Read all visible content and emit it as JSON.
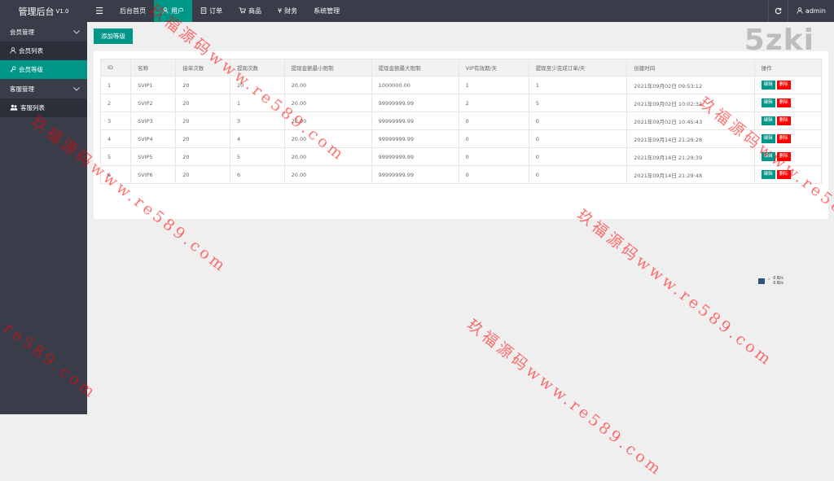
{
  "app": {
    "title": "管理后台",
    "version": "V1.0"
  },
  "topnav": {
    "menu_icon": "☰",
    "items": [
      {
        "label": "后台首页",
        "icon": ""
      },
      {
        "label": "用户",
        "icon": "user-icon"
      },
      {
        "label": "订单",
        "icon": "document-icon"
      },
      {
        "label": "商品",
        "icon": "cart-icon"
      },
      {
        "label": "财务",
        "icon": "yen-icon"
      },
      {
        "label": "系统管理",
        "icon": ""
      }
    ],
    "refresh_icon": "refresh-icon",
    "user": "admin"
  },
  "sidebar": {
    "groups": [
      {
        "label": "会员管理",
        "items": [
          {
            "label": "会员列表",
            "icon": "user-icon"
          },
          {
            "label": "会员等级",
            "icon": "key-icon"
          }
        ]
      },
      {
        "label": "客服管理",
        "items": [
          {
            "label": "客服列表",
            "icon": "users-icon"
          }
        ]
      }
    ]
  },
  "main": {
    "add_button": "添加等级",
    "brand": "5zki",
    "table": {
      "headers": [
        "ID",
        "名称",
        "接单次数",
        "提现次数",
        "提现金额最小限制",
        "提现金额最大限制",
        "VIP有效期/天",
        "提现至少完成订单/天",
        "创建时间",
        "操作"
      ],
      "rows": [
        [
          "1",
          "SVIP1",
          "20",
          "20",
          "20.00",
          "1000000.00",
          "1",
          "1",
          "2021年09月02日 09:53:12"
        ],
        [
          "2",
          "SVIP2",
          "20",
          "1",
          "20.00",
          "99999999.99",
          "2",
          "5",
          "2021年09月02日 10:02:32"
        ],
        [
          "3",
          "SVIP3",
          "20",
          "3",
          "20.00",
          "99999999.99",
          "0",
          "0",
          "2021年09月02日 10:45:43"
        ],
        [
          "4",
          "SVIP4",
          "20",
          "4",
          "20.00",
          "99999999.99",
          "0",
          "0",
          "2021年09月14日 21:29:28"
        ],
        [
          "5",
          "SVIP5",
          "20",
          "5",
          "20.00",
          "99999999.99",
          "0",
          "0",
          "2021年09月14日 21:29:39"
        ],
        [
          "6",
          "SVIP6",
          "20",
          "6",
          "20.00",
          "99999999.99",
          "0",
          "0",
          "2021年09月14日 21:29:48"
        ]
      ],
      "edit_label": "编辑",
      "delete_label": "删除"
    }
  },
  "netmon": {
    "up": "0 B/s",
    "down": "0 B/s"
  },
  "watermark": "玖福源码www.re589.com",
  "colors": {
    "accent": "#009688",
    "topbar": "#393d49",
    "danger": "#ff0000"
  }
}
